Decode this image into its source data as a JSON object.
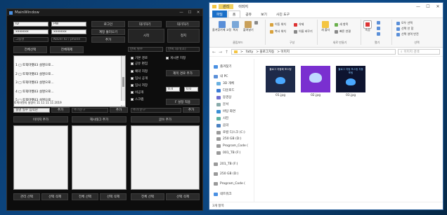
{
  "main_window": {
    "title": "MainWindow",
    "controls": [
      "—",
      "☐",
      "✕"
    ],
    "inputs_row1": [
      "ID",
      "PW"
    ],
    "inputs_row2": [
      "xxxxxxx",
      "xxxxxxx"
    ],
    "placeholders": [
      "그룹명",
      "Naver ID / phone"
    ],
    "top_buttons": [
      "로그인",
      "대기하기",
      "대기하기"
    ],
    "btn_row2": "계정 불러오기",
    "btn_add": "추가",
    "btn_select_all": "전체선택",
    "btn_deselect": "전체해제",
    "btn_start": "시작",
    "btn_stop": "정지",
    "interval_label": "반복 횟수",
    "interval_right": "반복 대기(초)",
    "checks_a": [
      "기본 경로",
      "공유 편집",
      "공개 공개"
    ],
    "check_right": "게시판 지정",
    "checks_b": [
      "예약 지정",
      "임시 공개",
      "임시 저장",
      "비공개",
      "스크랩"
    ],
    "btn_load_keyword": "제목 경로 추가",
    "list_items": [
      "1 □ 토픽마켓03 설명으로...",
      "2 □ 토픽마켓03 설명으로...",
      "3 □ 토픽마켓03 설명으로...",
      "4 □ 토픽마켓03 설명으로...",
      "5 □ 토픽마켓03 설명으로..."
    ],
    "list_footer": "토픽마켓의 설명이 11 11 11 11 2019",
    "small_inputs": [
      "0.4",
      "0.0"
    ],
    "btn_post": "F 설정 적용",
    "field_a": "설명 필수 입력란",
    "field_b": "추가문구",
    "field_c": "추가 문구",
    "btn_add_a": "추가",
    "btn_add_b": "추가",
    "btn_add_c": "추가",
    "section_buttons": [
      "이미지 추가",
      "해시태그 추가",
      "글쓰 추가"
    ],
    "bottom_buttons": [
      "관리 선택",
      "선택 삭제",
      "전체 선택",
      "선택 삭제",
      "전체 선택",
      "선택 삭제"
    ]
  },
  "explorer": {
    "title_tab": "관리",
    "title_sub": "사진 도구",
    "title_folder": "이미지",
    "controls": [
      "—",
      "☐",
      "✕"
    ],
    "tabs": [
      "파일",
      "홈",
      "공유",
      "보기",
      "사진 도구"
    ],
    "ribbon": {
      "clipboard": {
        "label": "클립보드",
        "items": [
          "즐겨찾기에 고정",
          "복사",
          "붙여넣기"
        ],
        "small": [
          "잘라내기",
          "경로 복사",
          "바로 가기 붙여넣기"
        ]
      },
      "organize": {
        "label": "구성",
        "small": [
          "이동 위치",
          "복사 위치"
        ],
        "small2": [
          "삭제",
          "이름 바꾸기"
        ]
      },
      "new": {
        "label": "새로 만들기",
        "items": [
          "새 폴더"
        ],
        "small": [
          "새 항목",
          "빠른 연결"
        ]
      },
      "open": {
        "label": "열기",
        "items": [
          "속성"
        ],
        "small": [
          "열기",
          "편집",
          "히스토리"
        ]
      },
      "select": {
        "label": "선택",
        "small": [
          "모두 선택",
          "선택 안 함",
          "선택 영역 반전"
        ]
      }
    },
    "address": {
      "crumbs": [
        "> ",
        "fatty",
        "> 블로그자동",
        "> 이미지"
      ],
      "search_placeholder": "이미지 검색"
    },
    "nav": [
      "즐겨찾기",
      "내 PC",
      "3D 개체",
      "다운로드",
      "동영상",
      "문서",
      "바탕 화면",
      "사진",
      "음악",
      "로컬 디스크 (C:)",
      "250 GB (D:)",
      "Program_Code (",
      "001_TB (F:)",
      "201_TB (F:)",
      "250 GB (D:)",
      "Program_Code (",
      "네트워크"
    ],
    "files": [
      {
        "name": "01.jpg",
        "text": "블로그 자동화 포스팅"
      },
      {
        "name": "02.jpg",
        "text": ""
      },
      {
        "name": "03.jpg",
        "text": "블로그 자동 포스팅 자동 포팅"
      }
    ],
    "status": "3개 항목"
  },
  "colors": {
    "explorer_file_tab": "#1a6fc8",
    "thumb1": "#1e2a4a",
    "thumb2": "#7a2fd0",
    "thumb3": "#0e1430",
    "bird": "#4aa8ff"
  }
}
